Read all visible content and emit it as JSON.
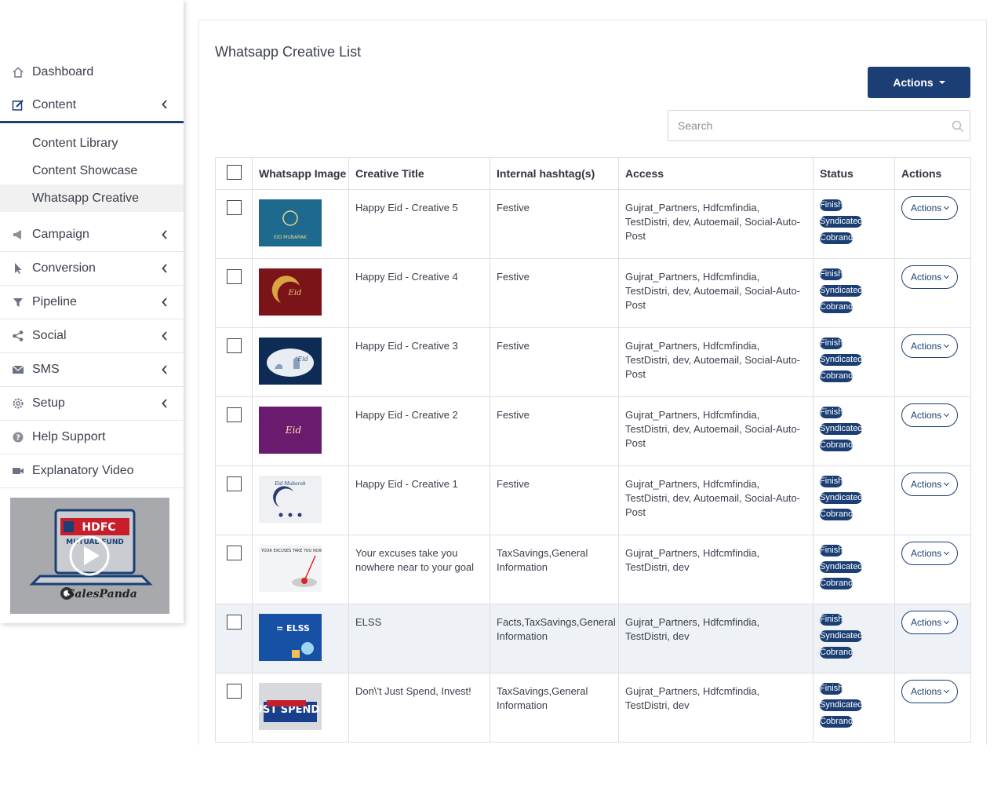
{
  "sidebar": {
    "items": [
      {
        "label": "Dashboard",
        "icon": "home-icon"
      },
      {
        "label": "Content",
        "icon": "edit-icon"
      },
      {
        "label": "Campaign",
        "icon": "megaphone-icon"
      },
      {
        "label": "Conversion",
        "icon": "cursor-icon"
      },
      {
        "label": "Pipeline",
        "icon": "filter-icon"
      },
      {
        "label": "Social",
        "icon": "share-icon"
      },
      {
        "label": "SMS",
        "icon": "envelope-icon"
      },
      {
        "label": "Setup",
        "icon": "gear-icon"
      },
      {
        "label": "Help Support",
        "icon": "question-icon"
      },
      {
        "label": "Explanatory Video",
        "icon": "video-camera-icon"
      }
    ],
    "content_subitems": [
      "Content Library",
      "Content Showcase",
      "Whatsapp Creative"
    ],
    "active_subitem": "Whatsapp Creative",
    "video_logo_text": "HDFC",
    "video_logo_subtext": "MUTUAL FUND",
    "video_brand": "SalesPanda"
  },
  "main": {
    "title": "Whatsapp Creative List",
    "actions_label": "Actions",
    "search_placeholder": "Search",
    "columns": [
      "Whatsapp Image",
      "Creative Title",
      "Internal hashtag(s)",
      "Access",
      "Status",
      "Actions"
    ],
    "rows": [
      {
        "title": "Happy Eid - Creative 5",
        "hashtags": "Festive",
        "access": "Gujrat_Partners, Hdfcmfindia, TestDistri, dev, Autoemail, Social-Auto-Post",
        "statuses": [
          "Finish",
          "Syndicated",
          "Cobrand"
        ],
        "action": "Actions",
        "image_caption": "EID MUBARAK"
      },
      {
        "title": "Happy Eid - Creative 4",
        "hashtags": "Festive",
        "access": "Gujrat_Partners, Hdfcmfindia, TestDistri, dev, Autoemail, Social-Auto-Post",
        "statuses": [
          "Finish",
          "Syndicated",
          "Cobrand"
        ],
        "action": "Actions",
        "image_caption": "Eid"
      },
      {
        "title": "Happy Eid - Creative 3",
        "hashtags": "Festive",
        "access": "Gujrat_Partners, Hdfcmfindia, TestDistri, dev, Autoemail, Social-Auto-Post",
        "statuses": [
          "Finish",
          "Syndicated",
          "Cobrand"
        ],
        "action": "Actions",
        "image_caption": "Eid"
      },
      {
        "title": "Happy Eid - Creative 2",
        "hashtags": "Festive",
        "access": "Gujrat_Partners, Hdfcmfindia, TestDistri, dev, Autoemail, Social-Auto-Post",
        "statuses": [
          "Finish",
          "Syndicated",
          "Cobrand"
        ],
        "action": "Actions",
        "image_caption": "Eid"
      },
      {
        "title": "Happy Eid - Creative 1",
        "hashtags": "Festive",
        "access": "Gujrat_Partners, Hdfcmfindia, TestDistri, dev, Autoemail, Social-Auto-Post",
        "statuses": [
          "Finish",
          "Syndicated",
          "Cobrand"
        ],
        "action": "Actions",
        "image_caption": "Eid Mubarak"
      },
      {
        "title": "Your excuses take you nowhere near to your goal",
        "hashtags": "TaxSavings,General Information",
        "access": "Gujrat_Partners, Hdfcmfindia, TestDistri, dev",
        "statuses": [
          "Finish",
          "Syndicated",
          "Cobrand"
        ],
        "action": "Actions",
        "image_caption": "YOUR EXCUSES TAKE YOU NOWHERE NEAR TO YOUR GOAL"
      },
      {
        "title": "ELSS",
        "hashtags": "Facts,TaxSavings,General Information",
        "access": "Gujrat_Partners, Hdfcmfindia, TestDistri, dev",
        "statuses": [
          "Finish",
          "Syndicated",
          "Cobrand"
        ],
        "action": "Actions",
        "image_caption": "= ELSS"
      },
      {
        "title": "Don\\'t Just Spend, Invest!",
        "hashtags": "TaxSavings,General Information",
        "access": "Gujrat_Partners, Hdfcmfindia, TestDistri, dev",
        "statuses": [
          "Finish",
          "Syndicated",
          "Cobrand"
        ],
        "action": "Actions",
        "image_caption": "DON'T JUST SPEND INVEST!"
      }
    ]
  },
  "colors": {
    "primary": "#1b3f74",
    "highlight_row": "#eef1f5"
  }
}
